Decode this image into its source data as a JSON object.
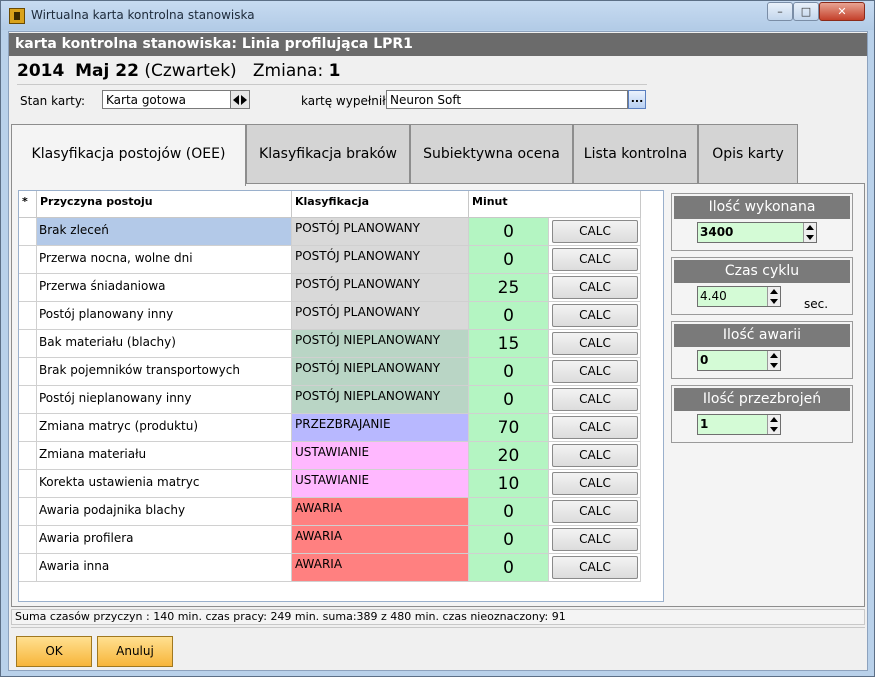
{
  "window": {
    "title": "Wirtualna karta kontrolna stanowiska"
  },
  "header": {
    "title": "karta kontrolna stanowiska: Linia profilująca LPR1"
  },
  "date": {
    "year": "2014",
    "month_day": "Maj 22",
    "weekday": "(Czwartek)",
    "shift_label": "Zmiana:",
    "shift_value": "1"
  },
  "form": {
    "state_label": "Stan karty:",
    "state_value": "Karta gotowa",
    "filled_label": "kartę wypełnił",
    "filled_value": "Neuron  Soft",
    "browse_label": "..."
  },
  "tabs": [
    {
      "label": "Klasyfikacja postojów (OEE)",
      "active": true
    },
    {
      "label": "Klasyfikacja braków"
    },
    {
      "label": "Subiektywna ocena"
    },
    {
      "label": "Lista kontrolna"
    },
    {
      "label": "Opis karty"
    }
  ],
  "grid": {
    "columns": [
      "*",
      "Przyczyna postoju",
      "Klasyfikacja",
      "Minut"
    ],
    "calc_label": "CALC",
    "rows": [
      {
        "reason": "Brak zleceń",
        "class": "POSTÓJ PLANOWANY",
        "minutes": "0"
      },
      {
        "reason": "Przerwa nocna, wolne dni",
        "class": "POSTÓJ PLANOWANY",
        "minutes": "0"
      },
      {
        "reason": "Przerwa śniadaniowa",
        "class": "POSTÓJ PLANOWANY",
        "minutes": "25"
      },
      {
        "reason": "Postój planowany inny",
        "class": "POSTÓJ PLANOWANY",
        "minutes": "0"
      },
      {
        "reason": "Bak materiału (blachy)",
        "class": "POSTÓJ NIEPLANOWANY",
        "minutes": "15"
      },
      {
        "reason": "Brak pojemników transportowych",
        "class": "POSTÓJ NIEPLANOWANY",
        "minutes": "0"
      },
      {
        "reason": "Postój nieplanowany inny",
        "class": "POSTÓJ NIEPLANOWANY",
        "minutes": "0"
      },
      {
        "reason": "Zmiana matryc (produktu)",
        "class": "PRZEZBRAJANIE",
        "minutes": "70"
      },
      {
        "reason": "Zmiana materiału",
        "class": "USTAWIANIE",
        "minutes": "20"
      },
      {
        "reason": "Korekta ustawienia matryc",
        "class": "USTAWIANIE",
        "minutes": "10"
      },
      {
        "reason": "Awaria podajnika blachy",
        "class": "AWARIA",
        "minutes": "0"
      },
      {
        "reason": "Awaria profilera",
        "class": "AWARIA",
        "minutes": "0"
      },
      {
        "reason": "Awaria inna",
        "class": "AWARIA",
        "minutes": "0"
      }
    ]
  },
  "class_colors": {
    "POSTÓJ PLANOWANY": "#d9d9d9",
    "POSTÓJ NIEPLANOWANY": "#b9d5c5",
    "PRZEZBRAJANIE": "#b8b8ff",
    "USTAWIANIE": "#ffb8ff",
    "AWARIA": "#ff8080",
    "selected": "#b3c9e8"
  },
  "side_panels": [
    {
      "label": "Ilość wykonana",
      "value": "3400",
      "unit": ""
    },
    {
      "label": "Czas cyklu",
      "value": "4.40",
      "unit": "sec."
    },
    {
      "label": "Ilość awarii",
      "value": "0",
      "unit": ""
    },
    {
      "label": "Ilość przezbrojeń",
      "value": "1",
      "unit": ""
    }
  ],
  "status": {
    "text": "Suma czasów przyczyn : 140 min.  czas pracy: 249 min.    suma:389 z 480 min.   czas nieoznaczony: 91"
  },
  "footer": {
    "ok_label": "OK",
    "cancel_label": "Anuluj"
  }
}
